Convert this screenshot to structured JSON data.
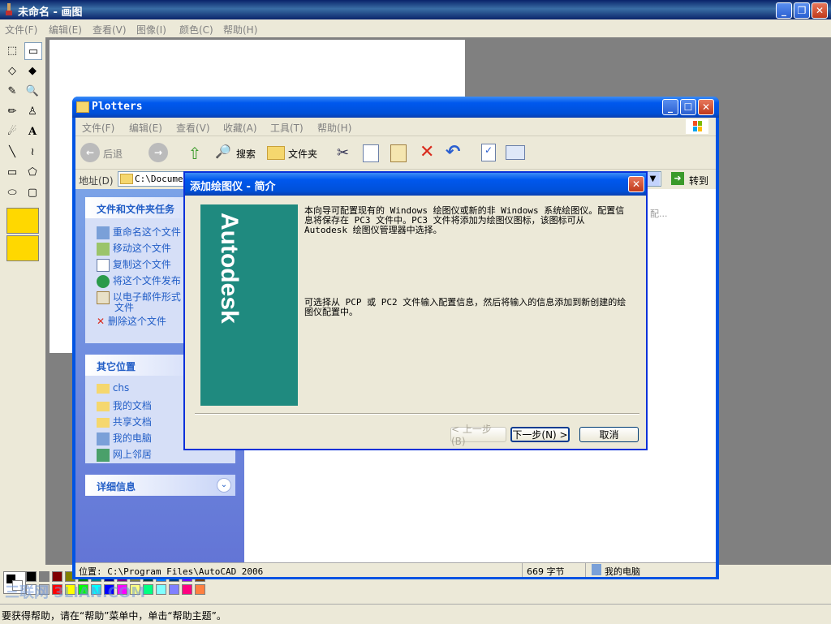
{
  "paint": {
    "title": "未命名 - 画图",
    "menu": [
      "文件(F)",
      "编辑(E)",
      "查看(V)",
      "图像(I)",
      "颜色(C)",
      "帮助(H)"
    ],
    "status": "要获得帮助，请在“帮助”菜单中，单击“帮助主题”。",
    "palette_colors": [
      "#000000",
      "#808080",
      "#800000",
      "#808000",
      "#008000",
      "#008080",
      "#000080",
      "#800080",
      "#808040",
      "#004040",
      "#0080ff",
      "#004080",
      "#8000ff",
      "#804000",
      "#ffffff",
      "#c0c0c0",
      "#ff0000",
      "#ffff00",
      "#00ff00",
      "#00ffff",
      "#0000ff",
      "#ff00ff",
      "#ffff80",
      "#00ff80",
      "#80ffff",
      "#8080ff",
      "#ff0080",
      "#ff8040"
    ],
    "watermark": "三联网 3LIAN.COM"
  },
  "explorer": {
    "title": "Plotters",
    "menu": [
      "文件(F)",
      "编辑(E)",
      "查看(V)",
      "收藏(A)",
      "工具(T)",
      "帮助(H)"
    ],
    "toolbar": {
      "back": "后退",
      "search": "搜索",
      "folders": "文件夹"
    },
    "address_label": "地址(D)",
    "address_value": "C:\\Documents and Settings",
    "go_label": "转到",
    "tasks_title": "文件和文件夹任务",
    "tasks": [
      "重命名这个文件",
      "移动这个文件",
      "复制这个文件",
      "将这个文件发布",
      "以电子邮件形式",
      "文件",
      "删除这个文件"
    ],
    "places_title": "其它位置",
    "places": [
      "chs",
      "我的文档",
      "共享文档",
      "我的电脑",
      "网上邻居"
    ],
    "details_title": "详细信息",
    "right_fragment": "配...",
    "status_location": "位置: C:\\Program Files\\AutoCAD 2006",
    "status_size": "669 字节",
    "status_computer": "我的电脑"
  },
  "dialog": {
    "title": "添加绘图仪 - 简介",
    "banner_brand": "Autodesk",
    "para1": "本向导可配置现有的 Windows 绘图仪或新的非 Windows 系统绘图仪。配置信息将保存在 PC3 文件中。PC3 文件将添加为绘图仪图标，该图标可从 Autodesk 绘图仪管理器中选择。",
    "para2": "可选择从 PCP 或 PC2 文件输入配置信息，然后将输入的信息添加到新创建的绘图仪配置中。",
    "back_button": "< 上一步(B)",
    "next_button": "下一步(N) >",
    "cancel_button": "取消"
  }
}
